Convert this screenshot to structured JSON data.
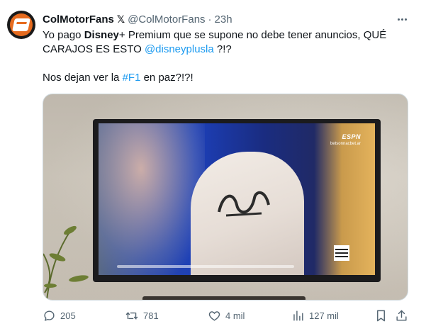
{
  "tweet": {
    "author": {
      "display_name": "ColMotorFans",
      "verified_badge": "𝕏",
      "handle": "@ColMotorFans",
      "separator": "·",
      "time": "23h"
    },
    "text": {
      "line1_pre": "Yo pago ",
      "line1_bold": "Disney",
      "line1_post": "+ Premium que se supone no debe tener anuncios, QUÉ",
      "line2_pre": "CARAJOS ES ESTO ",
      "line2_mention": "@disneyplusla",
      "line2_post": " ?!?",
      "line3_pre": "Nos dejan ver la ",
      "line3_hashtag": "#F1",
      "line3_post": " en paz?!?!"
    },
    "media": {
      "espn": "ESPN",
      "bet": "betsonnacbet.ar"
    },
    "actions": {
      "replies": "205",
      "retweets": "781",
      "likes": "4 mil",
      "views": "127 mil"
    },
    "icons": {
      "more": "more-horizontal-icon",
      "reply": "reply-icon",
      "retweet": "retweet-icon",
      "like": "heart-icon",
      "views": "views-chart-icon",
      "bookmark": "bookmark-icon",
      "share": "share-icon"
    },
    "colors": {
      "text": "#0f1419",
      "secondary": "#536471",
      "link": "#1d9bf0",
      "brand": "#e66b1f"
    }
  }
}
